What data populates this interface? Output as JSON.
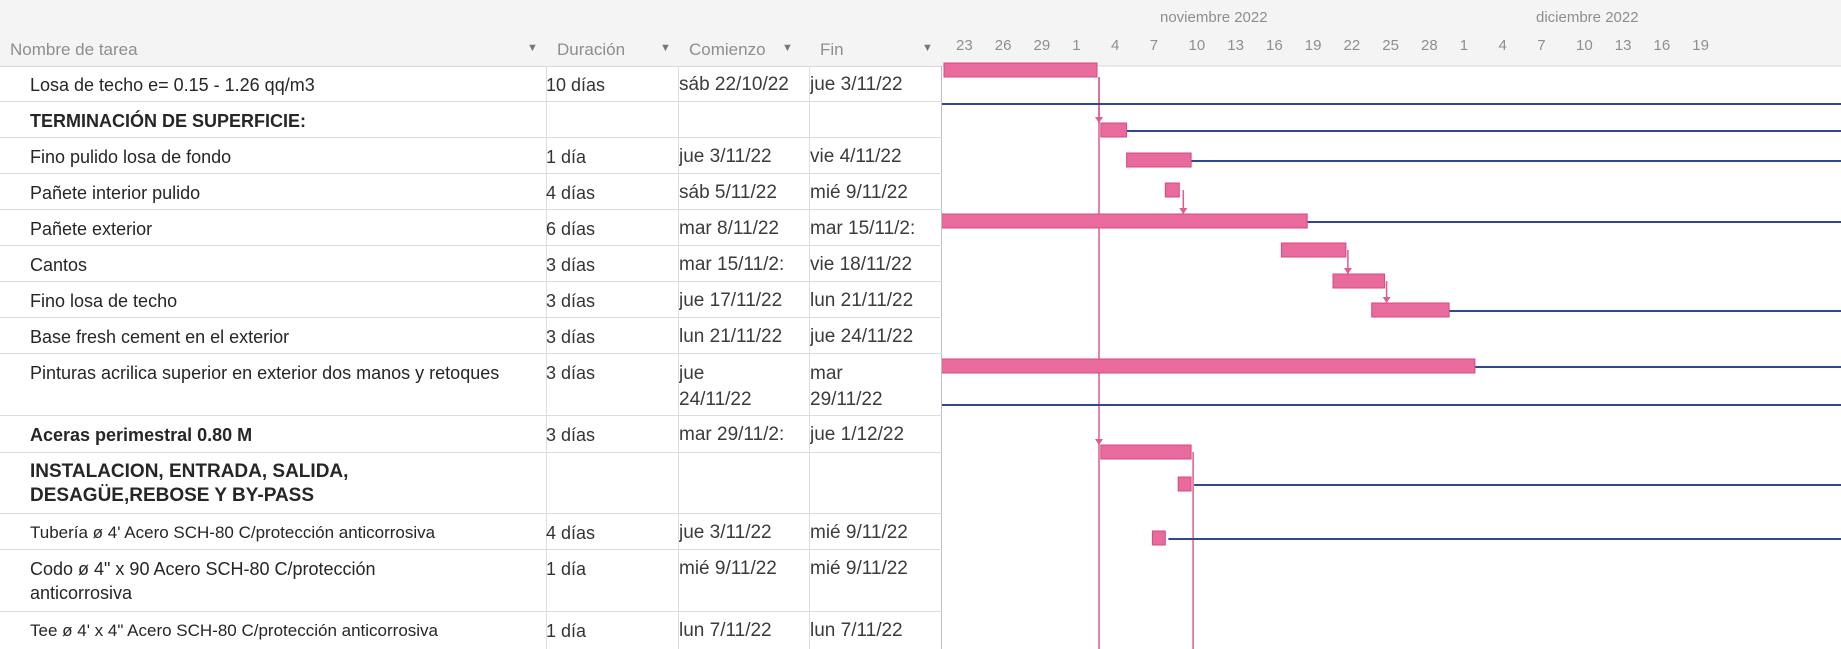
{
  "columns": {
    "name": "Nombre de tarea",
    "duration": "Duración",
    "start": "Comienzo",
    "end": "Fin"
  },
  "timescale": {
    "months": [
      "noviembre 2022",
      "diciembre 2022"
    ],
    "days": [
      "23",
      "26",
      "29",
      "1",
      "4",
      "7",
      "10",
      "13",
      "16",
      "19",
      "22",
      "25",
      "28",
      "1",
      "4",
      "7",
      "10",
      "13",
      "16",
      "19"
    ]
  },
  "tasks": [
    {
      "name": "Losa de techo e= 0.15 - 1.26 qq/m3",
      "duration": "10 días",
      "start": "sáb 22/10/22",
      "end": "jue 3/11/22",
      "bold": false
    },
    {
      "name": "TERMINACIÓN DE SUPERFICIE:",
      "duration": "",
      "start": "",
      "end": "",
      "bold": true
    },
    {
      "name": "Fino pulido losa de fondo",
      "duration": "1 día",
      "start": "jue 3/11/22",
      "end": "vie 4/11/22",
      "bold": false
    },
    {
      "name": "Pañete interior pulido",
      "duration": "4 días",
      "start": "sáb 5/11/22",
      "end": "mié 9/11/22",
      "bold": false
    },
    {
      "name": "Pañete exterior",
      "duration": "6 días",
      "start": "mar 8/11/22",
      "end": "mar 15/11/2:",
      "bold": false
    },
    {
      "name": "Cantos",
      "duration": "3 días",
      "start": "mar 15/11/2:",
      "end": "vie 18/11/22",
      "bold": false
    },
    {
      "name": "Fino losa de techo",
      "duration": "3 días",
      "start": "jue 17/11/22",
      "end": "lun 21/11/22",
      "bold": false
    },
    {
      "name": "Base fresh cement en el exterior",
      "duration": "3 días",
      "start": "lun 21/11/22",
      "end": "jue 24/11/22",
      "bold": false
    },
    {
      "name": "Pinturas acrilica superior en exterior dos manos y retoques",
      "duration": "3 días",
      "start": "jue 24/11/22",
      "end": "mar 29/11/22",
      "bold": false
    },
    {
      "name": "Aceras perimestral 0.80 M",
      "duration": "3 días",
      "start": "mar 29/11/2:",
      "end": "jue 1/12/22",
      "bold": true
    },
    {
      "name": "INSTALACION, ENTRADA, SALIDA, DESAGÜE,REBOSE Y BY-PASS",
      "duration": "",
      "start": "",
      "end": "",
      "bold": true
    },
    {
      "name": "Tubería ø 4' Acero SCH-80 C/protección anticorrosiva",
      "duration": "4 días",
      "start": "jue 3/11/22",
      "end": "mié 9/11/22",
      "bold": false
    },
    {
      "name": "Codo ø 4\" x 90 Acero SCH-80 C/protección anticorrosiva",
      "duration": "1 día",
      "start": "mié 9/11/22",
      "end": "mié 9/11/22",
      "bold": false
    },
    {
      "name": "Tee ø 4' x 4\" Acero SCH-80 C/protección anticorrosiva",
      "duration": "1 día",
      "start": "lun 7/11/22",
      "end": "lun 7/11/22",
      "bold": false
    }
  ],
  "colors": {
    "bar_fill": "#e96a9c",
    "bar_border": "#d64a84",
    "baseline": "#2f4a8a",
    "link": "#e05a93",
    "header_bg": "#f4f4f4"
  }
}
